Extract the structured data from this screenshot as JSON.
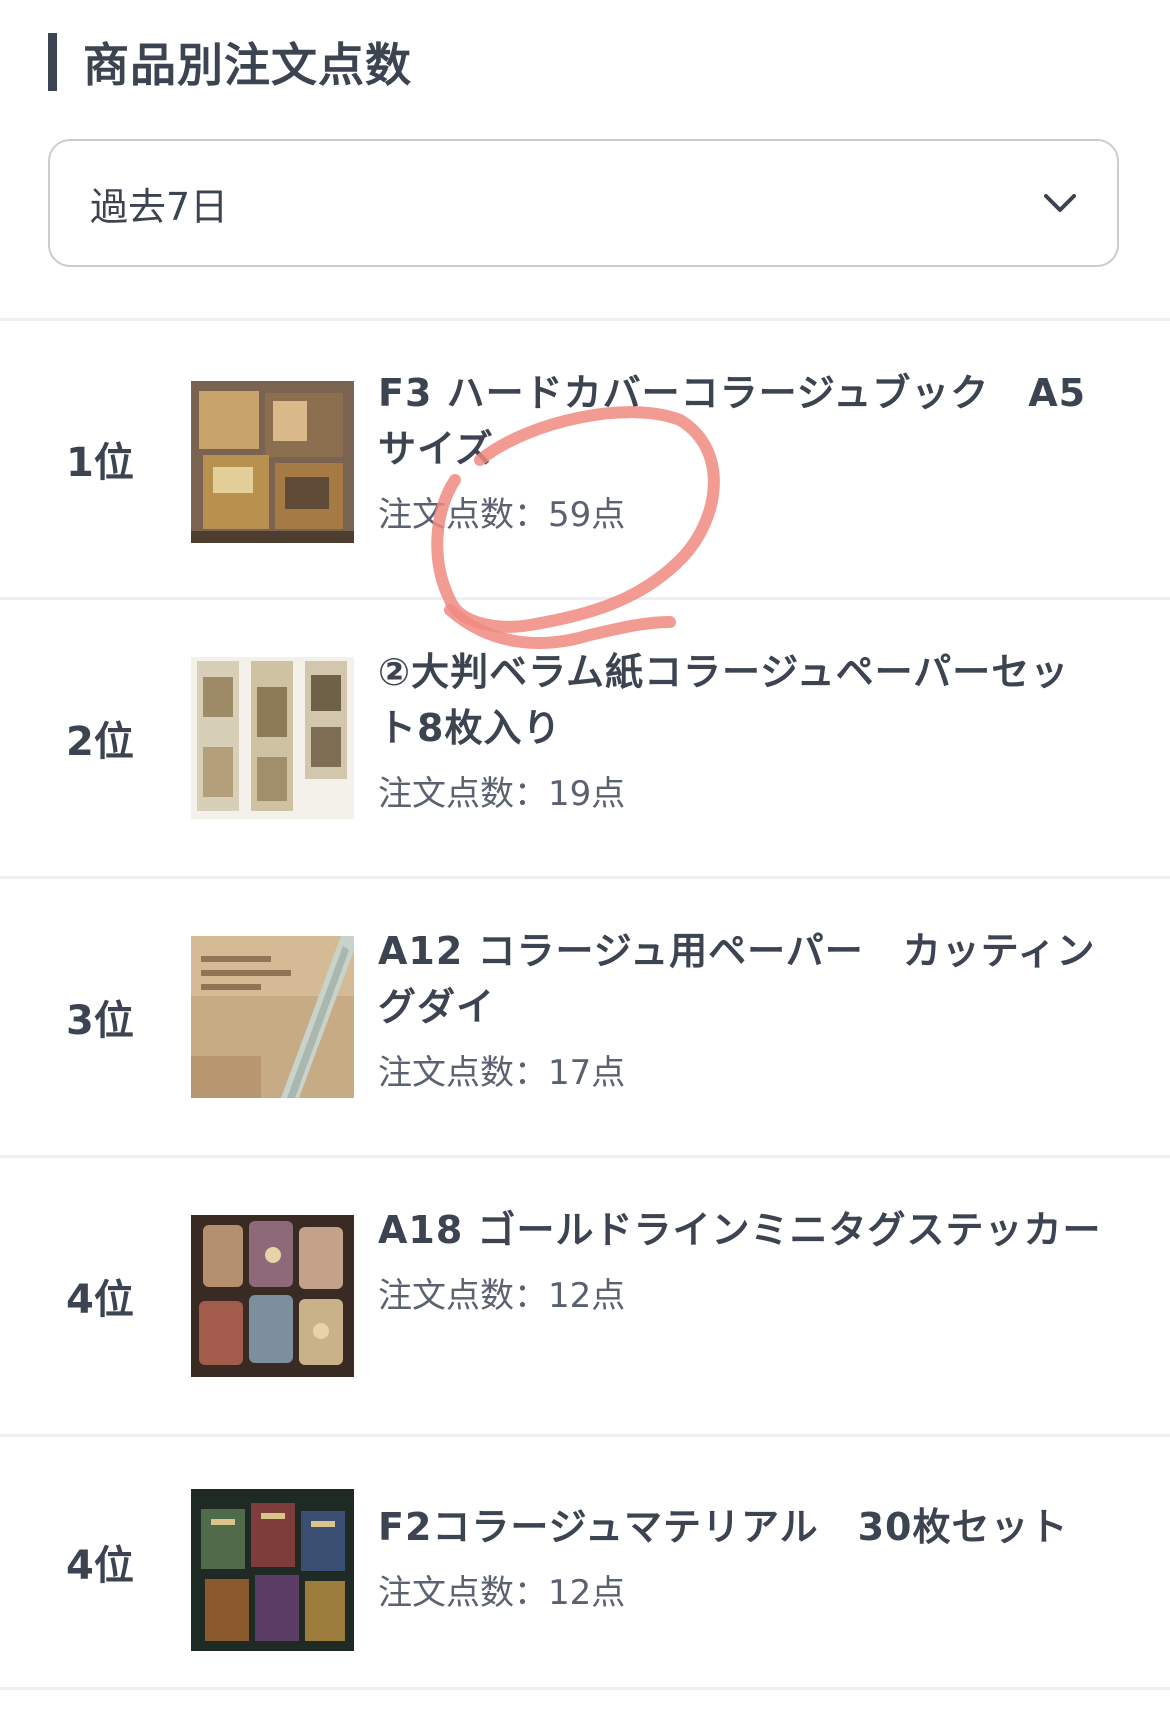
{
  "header": {
    "title": "商品別注文点数"
  },
  "period_select": {
    "value": "過去7日"
  },
  "ranking": [
    {
      "rank": "1位",
      "name": "F3 ハードカバーコラージュブック　A5サイズ",
      "count": "注文点数：59点"
    },
    {
      "rank": "2位",
      "name": "②大判ベラム紙コラージュペーパーセット8枚入り",
      "count": "注文点数：19点"
    },
    {
      "rank": "3位",
      "name": "A12 コラージュ用ペーパー　カッティングダイ",
      "count": "注文点数：17点"
    },
    {
      "rank": "4位",
      "name": "A18 ゴールドラインミニタグステッカー",
      "count": "注文点数：12点"
    },
    {
      "rank": "4位",
      "name": "F2コラージュマテリアル　30枚セット",
      "count": "注文点数：12点"
    }
  ],
  "colors": {
    "text": "#3d4451",
    "annotation_stroke": "#f08a80",
    "divider": "#eeeff2"
  },
  "icons": {
    "select_chevron": "chevron-down-icon"
  }
}
